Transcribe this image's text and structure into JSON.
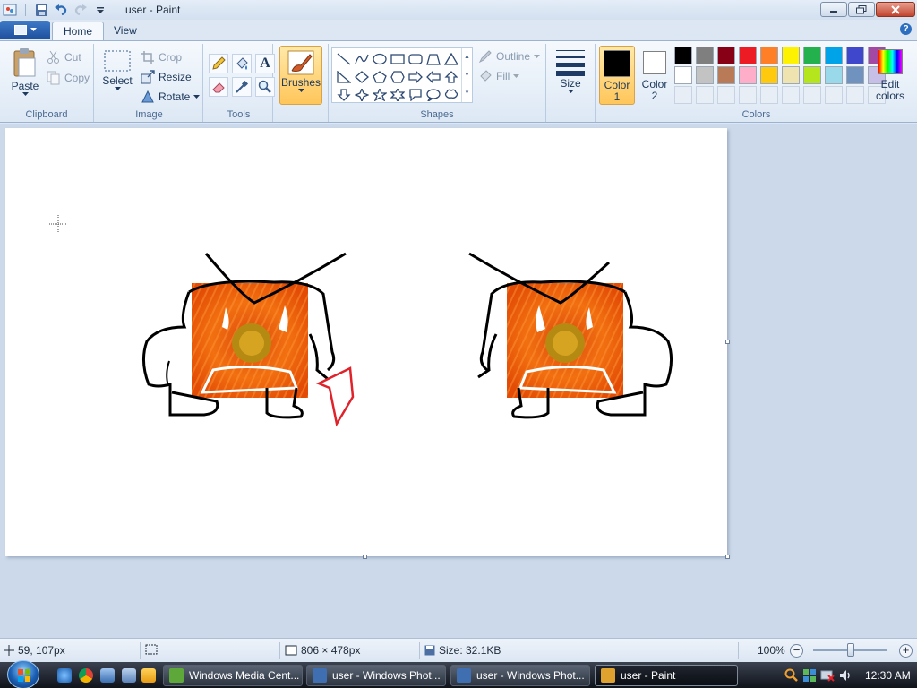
{
  "window": {
    "title": "user - Paint"
  },
  "tabs": {
    "home": "Home",
    "view": "View"
  },
  "clipboard": {
    "paste": "Paste",
    "cut": "Cut",
    "copy": "Copy",
    "label": "Clipboard"
  },
  "image": {
    "select": "Select",
    "crop": "Crop",
    "resize": "Resize",
    "rotate": "Rotate",
    "label": "Image"
  },
  "tools": {
    "label": "Tools",
    "text_glyph": "A"
  },
  "brushes": {
    "label": "Brushes"
  },
  "shapes": {
    "outline": "Outline",
    "fill": "Fill",
    "label": "Shapes"
  },
  "size": {
    "label": "Size"
  },
  "colors": {
    "color1_line1": "Color",
    "color1_line2": "1",
    "color2_line1": "Color",
    "color2_line2": "2",
    "color1_value": "#000000",
    "color2_value": "#ffffff",
    "edit_line1": "Edit",
    "edit_line2": "colors",
    "label": "Colors",
    "palette": [
      "#000000",
      "#7f7f7f",
      "#880015",
      "#ed1c24",
      "#ff7f27",
      "#fff200",
      "#22b14c",
      "#00a2e8",
      "#3f48cc",
      "#a349a4",
      "#ffffff",
      "#c3c3c3",
      "#b97a57",
      "#ffaec9",
      "#ffc90e",
      "#efe4b0",
      "#b5e61d",
      "#99d9ea",
      "#7092be",
      "#c8bfe7"
    ],
    "empty_slots": 10
  },
  "status": {
    "cursor_pos": "59, 107px",
    "canvas_size": "806 × 478px",
    "file_size": "Size: 32.1KB",
    "zoom": "100%"
  },
  "taskbar": {
    "buttons": [
      {
        "label": "Windows Media Cent...",
        "icon_color": "#5ea83a"
      },
      {
        "label": "user - Windows Phot...",
        "icon_color": "#3f6fb0"
      },
      {
        "label": "user - Windows Phot...",
        "icon_color": "#3f6fb0"
      },
      {
        "label": "user - Paint",
        "icon_color": "#e0a22e"
      }
    ],
    "clock": "12:30 AM"
  }
}
